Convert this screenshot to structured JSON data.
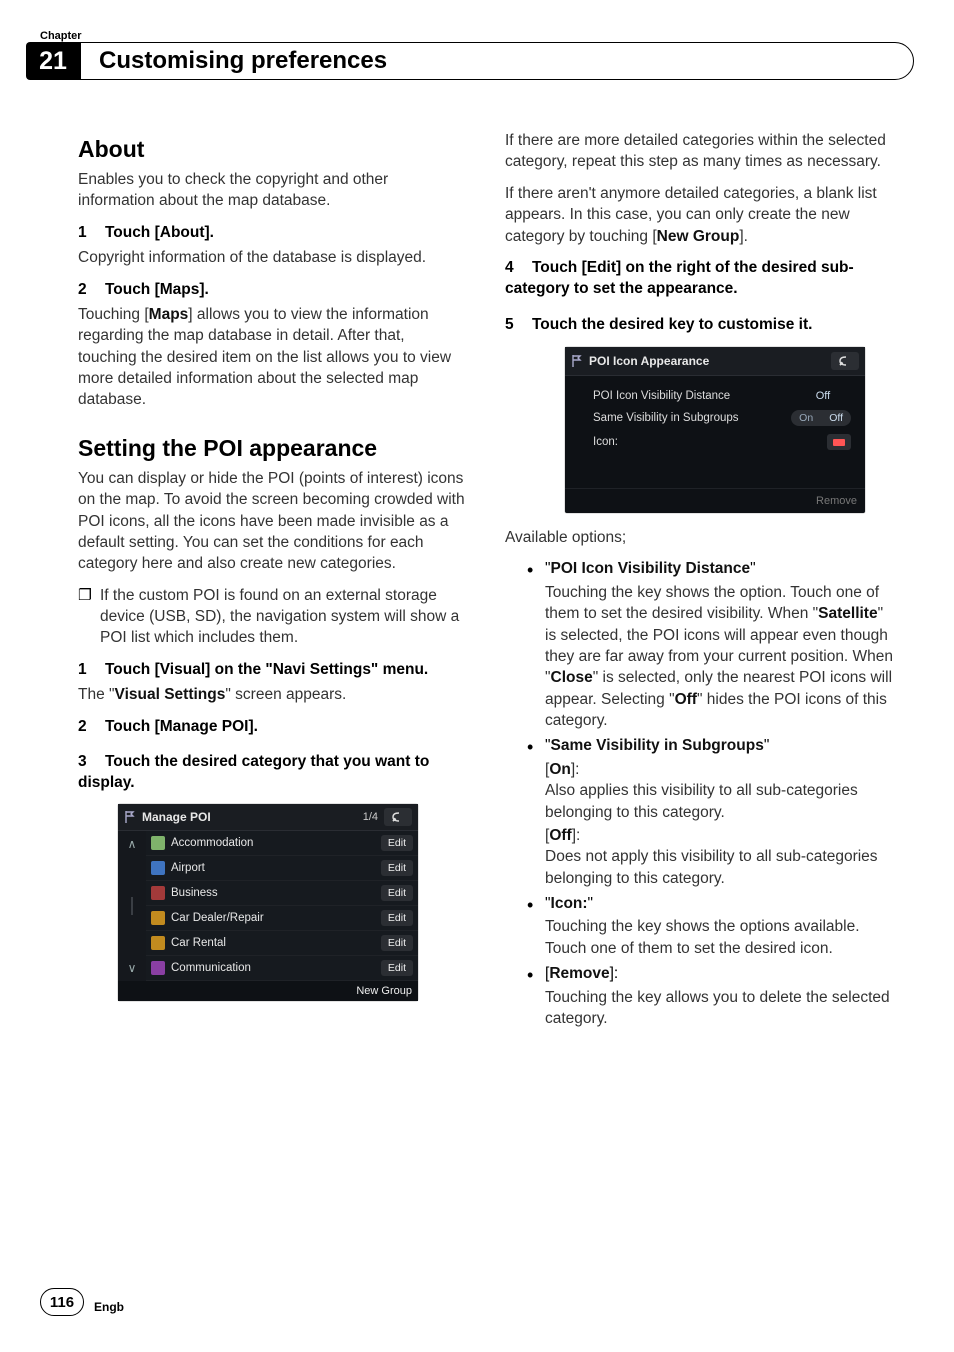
{
  "header": {
    "chapter_label": "Chapter",
    "chapter_number": "21",
    "title": "Customising preferences"
  },
  "left": {
    "about": {
      "heading": "About",
      "intro": "Enables you to check the copyright and other information about the map database.",
      "step1_num": "1",
      "step1_text": "Touch [About].",
      "step1_body": "Copyright information of the database is displayed.",
      "step2_num": "2",
      "step2_text": "Touch [Maps].",
      "step2_body_a": "Touching [",
      "step2_body_strong": "Maps",
      "step2_body_b": "] allows you to view the information regarding the map database in detail. After that, touching the desired item on the list allows you to view more detailed information about the selected map database."
    },
    "poi": {
      "heading": "Setting the POI appearance",
      "intro": "You can display or hide the POI (points of interest) icons on the map. To avoid the screen becoming crowded with POI icons, all the icons have been made invisible as a default setting. You can set the conditions for each category here and also create new categories.",
      "note_gutter": "❐",
      "note": "If the custom POI is found on an external storage device (USB, SD), the navigation system will show a POI list which includes them.",
      "step1_num": "1",
      "step1_text": "Touch [Visual] on the \"Navi Settings\" menu.",
      "step1_body_a": "The \"",
      "step1_body_strong": "Visual Settings",
      "step1_body_b": "\" screen appears.",
      "step2_num": "2",
      "step2_text": "Touch [Manage POI].",
      "step3_num": "3",
      "step3_text": "Touch the desired category that you want to display."
    }
  },
  "managepoi": {
    "title": "Manage POI",
    "page": "1/4",
    "rows": [
      {
        "icon": "#7fb36b",
        "label": "Accommodation",
        "edit": "Edit"
      },
      {
        "icon": "#3f74c0",
        "label": "Airport",
        "edit": "Edit"
      },
      {
        "icon": "#a33a3a",
        "label": "Business",
        "edit": "Edit"
      },
      {
        "icon": "#c28b1f",
        "label": "Car Dealer/Repair",
        "edit": "Edit"
      },
      {
        "icon": "#c28b1f",
        "label": "Car Rental",
        "edit": "Edit"
      },
      {
        "icon": "#8a3fa3",
        "label": "Communication",
        "edit": "Edit"
      }
    ],
    "newgroup": "New Group"
  },
  "right": {
    "p1_a": "If there are more detailed categories within the selected category, repeat this step as many times as necessary.",
    "p1_b_a": "If there aren't anymore detailed categories, a blank list appears. In this case, you can only create the new category by touching [",
    "p1_b_strong": "New Group",
    "p1_b_b": "].",
    "step4_num": "4",
    "step4_text": "Touch [Edit] on the right of the desired sub-category to set the appearance.",
    "step5_num": "5",
    "step5_text": "Touch the desired key to customise it.",
    "available": "Available options;",
    "opt1_title": "POI Icon Visibility Distance",
    "opt1_body_a": "Touching the key shows the option. Touch one of them to set the desired visibility. When \"",
    "opt1_sat": "Satellite",
    "opt1_body_b": "\" is selected, the POI icons will appear even though they are far away from your current position. When \"",
    "opt1_close": "Close",
    "opt1_body_c": "\" is selected, only the nearest POI icons will appear. Selecting \"",
    "opt1_off": "Off",
    "opt1_body_d": "\" hides the POI icons of this category.",
    "opt2_title": "Same Visibility in Subgroups",
    "opt2_on": "On",
    "opt2_on_body": "Also applies this visibility to all sub-categories belonging to this category.",
    "opt2_off": "Off",
    "opt2_off_body": "Does not apply this visibility to all sub-categories belonging to this category.",
    "opt3_title": "Icon:",
    "opt3_body": "Touching the key shows the options available. Touch one of them to set the desired icon.",
    "opt4_title": "Remove",
    "opt4_body": "Touching the key allows you to delete the selected category."
  },
  "poiapp": {
    "title": "POI Icon Appearance",
    "row1_label": "POI Icon Visibility Distance",
    "row1_value": "Off",
    "row2_label": "Same Visibility in Subgroups",
    "row2_on": "On",
    "row2_off": "Off",
    "row3_label": "Icon:",
    "remove": "Remove"
  },
  "footer": {
    "page": "116",
    "lang": "Engb"
  }
}
